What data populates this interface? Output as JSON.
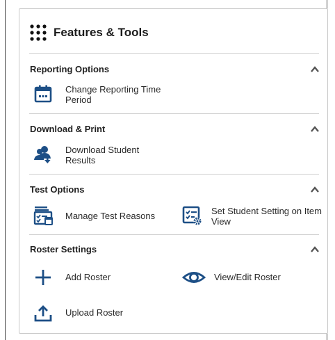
{
  "panel": {
    "title": "Features & Tools"
  },
  "sections": [
    {
      "title": "Reporting Options",
      "items": [
        "Change Reporting Time Period"
      ]
    },
    {
      "title": "Download & Print",
      "items": [
        "Download Student Results"
      ]
    },
    {
      "title": "Test Options",
      "items": [
        "Manage Test Reasons",
        "Set Student Setting on Item View"
      ]
    },
    {
      "title": "Roster Settings",
      "items": [
        "Add Roster",
        "View/Edit Roster",
        "Upload Roster"
      ]
    }
  ],
  "icons": {
    "header": "grid-dots-icon",
    "reporting": "calendar-icon",
    "download": "users-download-icon",
    "reasons": "checklist-stack-icon",
    "setting": "checklist-gear-icon",
    "add": "plus-icon",
    "view": "eye-icon",
    "upload": "upload-icon",
    "collapse": "chevron-up-icon"
  },
  "colors": {
    "accent": "#1d4f86",
    "text": "#222222",
    "border": "#c9c9c9"
  }
}
